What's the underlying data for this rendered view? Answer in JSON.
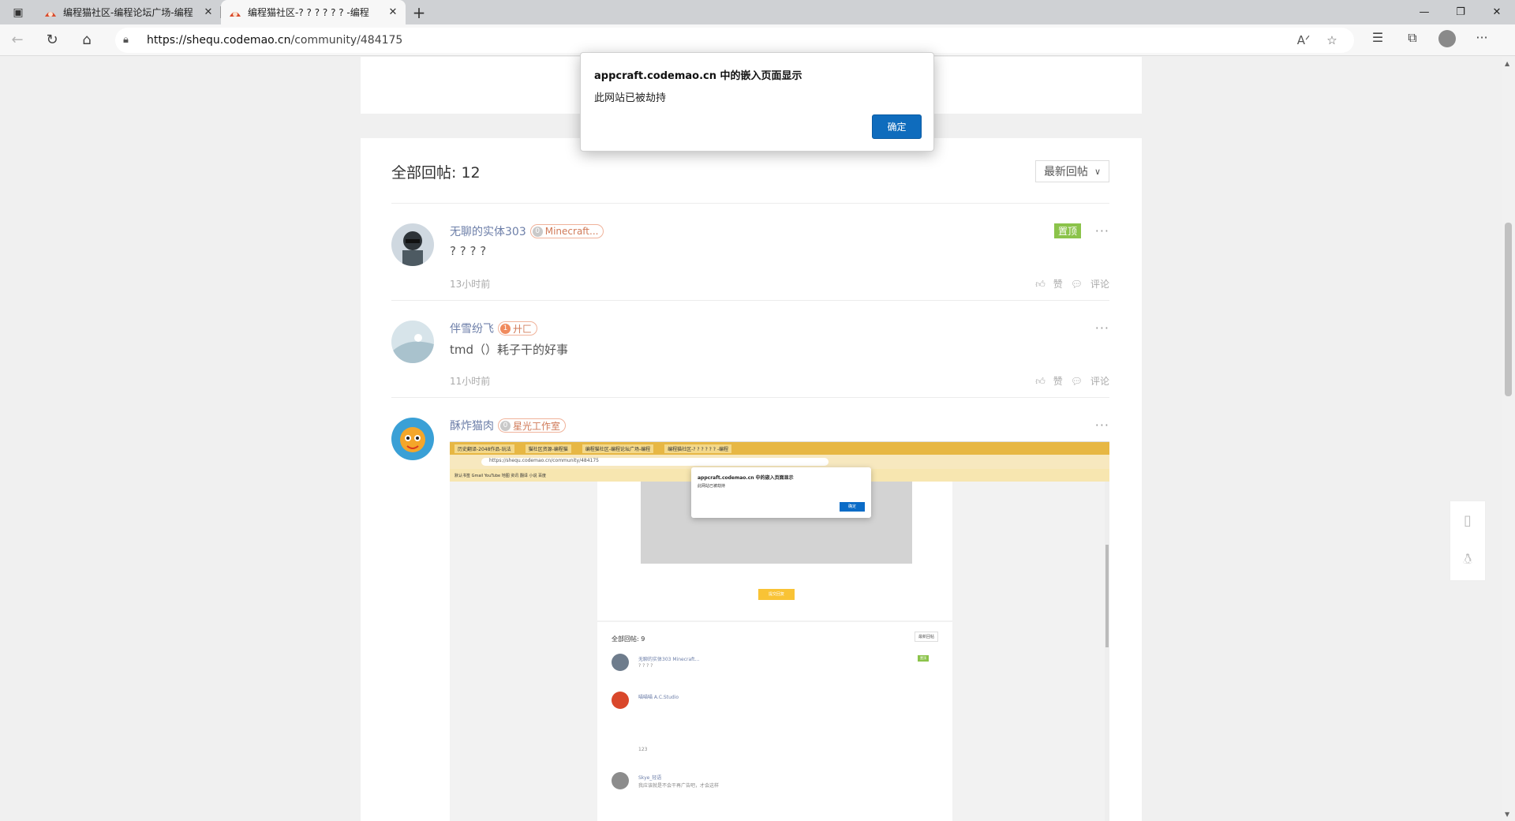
{
  "browser": {
    "tabs": [
      {
        "title": "编程猫社区-编程论坛广场-编程",
        "active": false
      },
      {
        "title": "编程猫社区-? ? ? ? ? ? -编程",
        "active": true
      }
    ],
    "url_host": "https://shequ.codemao.cn",
    "url_path": "/community/484175"
  },
  "dialog": {
    "title": "appcraft.codemao.cn 中的嵌入页面显示",
    "message": "此网站已被劫持",
    "ok_label": "确定"
  },
  "replies": {
    "title": "全部回帖: 12",
    "sort_label": "最新回帖",
    "items": [
      {
        "name": "无聊的实体303",
        "level": "0",
        "badge": "Minecraft...",
        "pinned": "置顶",
        "content": "? ? ? ?",
        "time": "13小时前",
        "like": "赞",
        "comment": "评论"
      },
      {
        "name": "伴雪纷飞",
        "level": "1",
        "badge": "廾匚",
        "content": "tmd（）耗子干的好事",
        "time": "11小时前",
        "like": "赞",
        "comment": "评论"
      },
      {
        "name": "酥炸猫肉",
        "level": "0",
        "badge": "星光工作室"
      }
    ]
  },
  "nested_shot": {
    "tabs": [
      "历史翻译-2048作品-玩法",
      "猫社区资源-编程猫",
      "编程猫社区-编程论坛广场-编程",
      "编程猫社区-? ? ? ? ? ? -编程"
    ],
    "url": "https://shequ.codemao.cn/community/484175",
    "bookmarks": "默认书签   Gmail   YouTube   地图   资讯   翻译   小说   百度",
    "dialog_title": "appcraft.codemao.cn 中的嵌入页面显示",
    "dialog_message": "此网站已被劫持",
    "dialog_ok": "确定",
    "yellow_btn": "提交回复",
    "replies_title": "全部回帖: 9",
    "sort": "最新回帖",
    "r1_name": "无聊的实体303  Minecraft...",
    "r1_text": "? ? ? ?",
    "r1_pin": "置顶",
    "r2_name": "喵喵喵  A.C.Studio",
    "r2_text": "123",
    "r3_name": "Skye_轻语",
    "r3_text": "我应该就是不会干再广告吧，才会这样"
  }
}
